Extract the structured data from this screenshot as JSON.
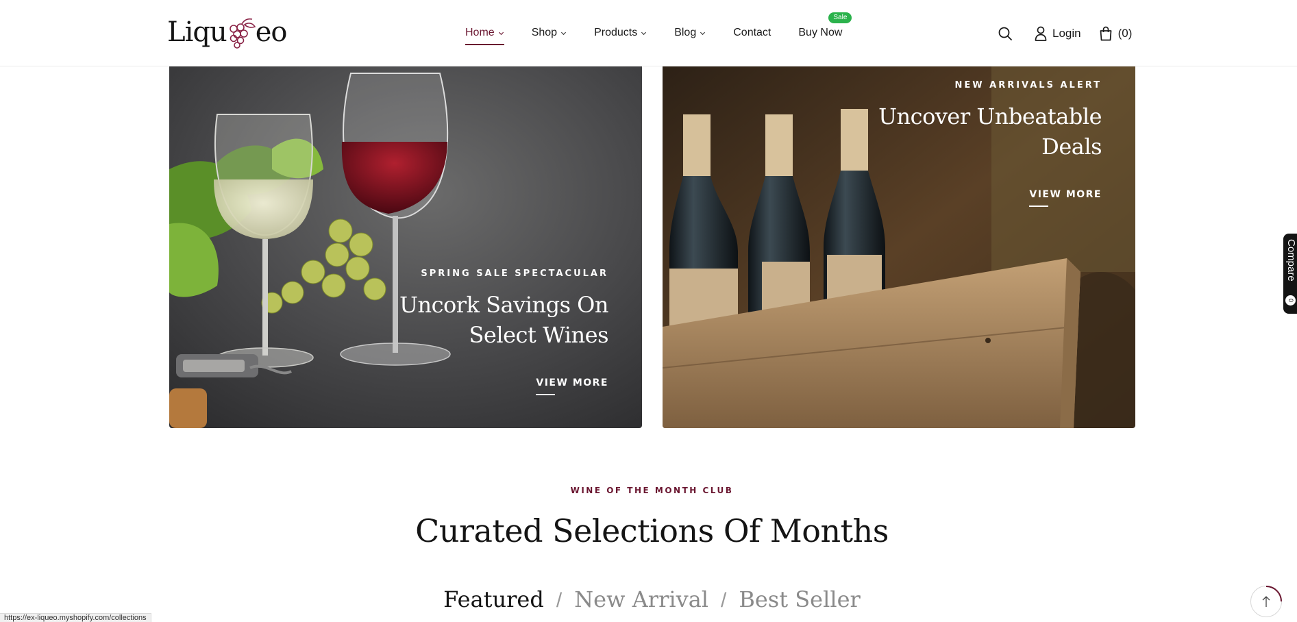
{
  "header": {
    "logo_text_left": "Liqu",
    "logo_text_right": "eo",
    "logo_icon": "grape-cluster-icon",
    "nav": [
      {
        "label": "Home",
        "has_dropdown": true,
        "active": true
      },
      {
        "label": "Shop",
        "has_dropdown": true,
        "active": false
      },
      {
        "label": "Products",
        "has_dropdown": true,
        "active": false
      },
      {
        "label": "Blog",
        "has_dropdown": true,
        "active": false
      },
      {
        "label": "Contact",
        "has_dropdown": false,
        "active": false
      },
      {
        "label": "Buy Now",
        "has_dropdown": false,
        "active": false,
        "badge": "Sale"
      }
    ],
    "login_label": "Login",
    "cart_count": "(0)",
    "icons": {
      "search": "search-icon",
      "user": "user-icon",
      "cart": "shopping-bag-icon"
    }
  },
  "banners": {
    "left": {
      "eyebrow": "SPRING SALE SPECTACULAR",
      "title_line1": "Uncork Savings On",
      "title_line2": "Select Wines",
      "cta": "VIEW MORE"
    },
    "right": {
      "eyebrow": "NEW ARRIVALS ALERT",
      "title_line1": "Uncover Unbeatable",
      "title_line2": "Deals",
      "cta": "VIEW MORE"
    }
  },
  "section": {
    "eyebrow": "WINE OF THE MONTH CLUB",
    "title": "Curated Selections Of Months",
    "tabs": [
      {
        "label": "Featured",
        "active": true
      },
      {
        "label": "New Arrival",
        "active": false
      },
      {
        "label": "Best Seller",
        "active": false
      }
    ],
    "separator": "/"
  },
  "compare": {
    "label": "Compare",
    "count": "0"
  },
  "status_bar": {
    "url": "https://ex-liqueo.myshopify.com/collections"
  },
  "colors": {
    "accent": "#6a1630",
    "sale_badge": "#2bb24c",
    "text": "#141414"
  }
}
